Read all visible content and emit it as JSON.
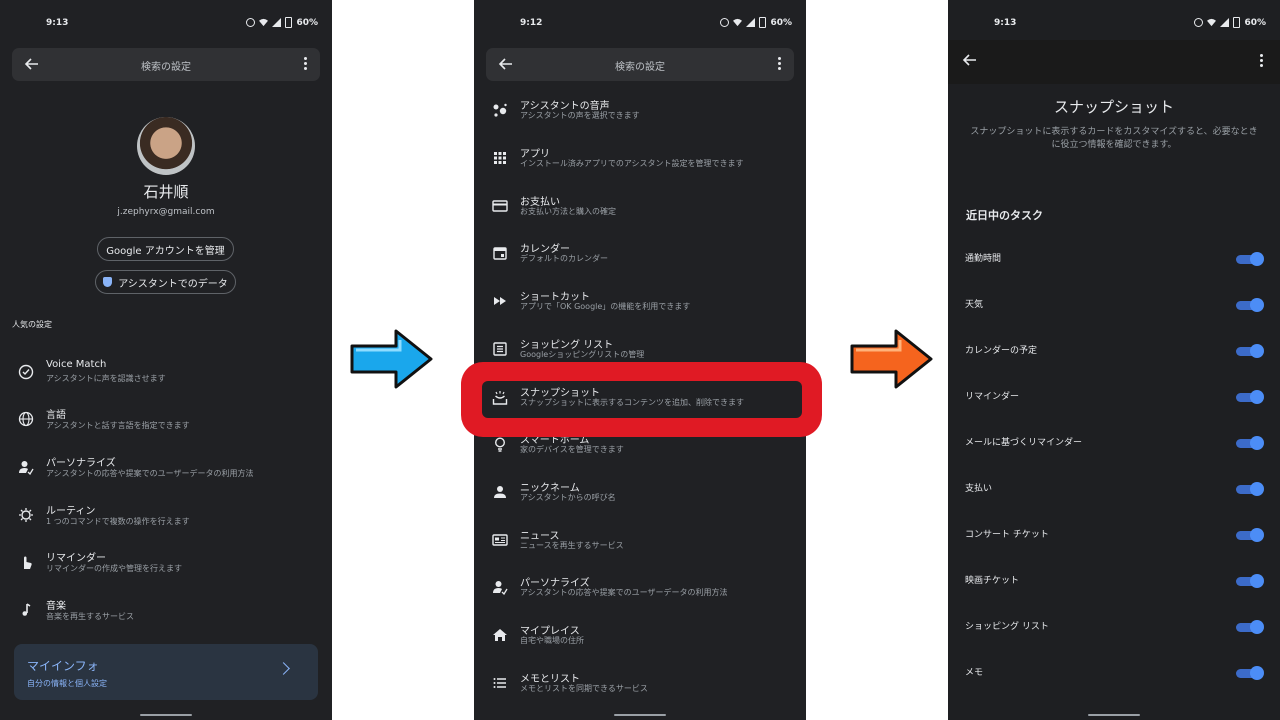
{
  "panel1": {
    "status": {
      "time": "9:13",
      "battery": "60%"
    },
    "header": {
      "title": "検索の設定"
    },
    "profile": {
      "name": "石井順",
      "email": "j.zephyrx@gmail.com"
    },
    "buttons": {
      "manage_account": "Google アカウントを管理",
      "assistant_data": "アシスタントでのデータ"
    },
    "section_label": "人気の設定",
    "items": [
      {
        "title": "Voice Match",
        "subtitle": "アシスタントに声を認識させます",
        "icon": "voice-match-icon"
      },
      {
        "title": "言語",
        "subtitle": "アシスタントと話す言語を指定できます",
        "icon": "globe-icon"
      },
      {
        "title": "パーソナライズ",
        "subtitle": "アシスタントの応答や提案でのユーザーデータの利用方法",
        "icon": "person-settings-icon"
      },
      {
        "title": "ルーティン",
        "subtitle": "1 つのコマンドで複数の操作を行えます",
        "icon": "routine-icon"
      },
      {
        "title": "リマインダー",
        "subtitle": "リマインダーの作成や管理を行えます",
        "icon": "hand-pointer-icon"
      },
      {
        "title": "音楽",
        "subtitle": "音楽を再生するサービス",
        "icon": "music-note-icon"
      }
    ],
    "card": {
      "title": "マイインフォ",
      "subtitle": "自分の情報と個人設定"
    }
  },
  "panel2": {
    "status": {
      "time": "9:12",
      "battery": "60%"
    },
    "header": {
      "title": "検索の設定"
    },
    "items": [
      {
        "title": "アシスタントの音声",
        "subtitle": "アシスタントの声を選択できます",
        "icon": "assistant-voice-icon"
      },
      {
        "title": "アプリ",
        "subtitle": "インストール済みアプリでのアシスタント設定を管理できます",
        "icon": "apps-grid-icon"
      },
      {
        "title": "お支払い",
        "subtitle": "お支払い方法と購入の確定",
        "icon": "credit-card-icon"
      },
      {
        "title": "カレンダー",
        "subtitle": "デフォルトのカレンダー",
        "icon": "calendar-icon"
      },
      {
        "title": "ショートカット",
        "subtitle": "アプリで「OK Google」の機能を利用できます",
        "icon": "fast-forward-icon"
      },
      {
        "title": "ショッピング リスト",
        "subtitle": "Googleショッピングリストの管理",
        "icon": "list-box-icon"
      },
      {
        "title": "スナップショット",
        "subtitle": "スナップショットに表示するコンテンツを追加、削除できます",
        "icon": "snapshot-icon"
      },
      {
        "title": "スマートホーム",
        "subtitle": "家のデバイスを管理できます",
        "icon": "lightbulb-icon"
      },
      {
        "title": "ニックネーム",
        "subtitle": "アシスタントからの呼び名",
        "icon": "person-icon"
      },
      {
        "title": "ニュース",
        "subtitle": "ニュースを再生するサービス",
        "icon": "news-icon"
      },
      {
        "title": "パーソナライズ",
        "subtitle": "アシスタントの応答や提案でのユーザーデータの利用方法",
        "icon": "person-settings-icon"
      },
      {
        "title": "マイプレイス",
        "subtitle": "自宅や職場の住所",
        "icon": "home-icon"
      },
      {
        "title": "メモとリスト",
        "subtitle": "メモとリストを同期できるサービス",
        "icon": "list-icon"
      }
    ]
  },
  "panel3": {
    "status": {
      "time": "9:13",
      "battery": "60%"
    },
    "title": "スナップショット",
    "description": "スナップショットに表示するカードをカスタマイズすると、必要なときに役立つ情報を確認できます。",
    "section": "近日中のタスク",
    "toggles": [
      {
        "label": "通勤時間",
        "on": true
      },
      {
        "label": "天気",
        "on": true
      },
      {
        "label": "カレンダーの予定",
        "on": true
      },
      {
        "label": "リマインダー",
        "on": true
      },
      {
        "label": "メールに基づくリマインダー",
        "on": true
      },
      {
        "label": "支払い",
        "on": true
      },
      {
        "label": "コンサート チケット",
        "on": true
      },
      {
        "label": "映画チケット",
        "on": true
      },
      {
        "label": "ショッピング リスト",
        "on": true
      },
      {
        "label": "メモ",
        "on": true
      }
    ]
  },
  "colors": {
    "highlight": "#e01a24",
    "arrow1": "#1aa7ec",
    "arrow2": "#f5641e",
    "toggle_on": "#4c8df6",
    "link": "#8ab4f8"
  }
}
